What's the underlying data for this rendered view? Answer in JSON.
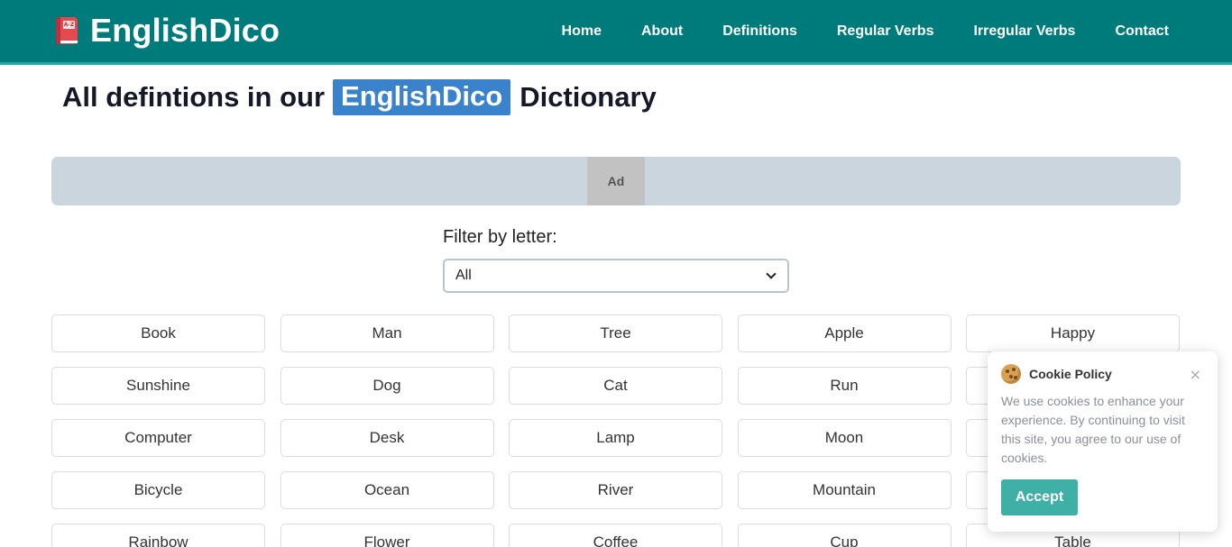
{
  "header": {
    "brand": "EnglishDico",
    "brand_icon": "book-az-icon",
    "brand_icon_text": "A-Z",
    "nav": [
      "Home",
      "About",
      "Definitions",
      "Regular Verbs",
      "Irregular Verbs",
      "Contact"
    ]
  },
  "title": {
    "before": "All defintions in our",
    "highlight": "EnglishDico",
    "after": "Dictionary"
  },
  "ad": {
    "label": "Ad"
  },
  "filter": {
    "label": "Filter by letter:",
    "selected": "All"
  },
  "words": [
    "Book",
    "Man",
    "Tree",
    "Apple",
    "Happy",
    "Sunshine",
    "Dog",
    "Cat",
    "Run",
    "",
    "Computer",
    "Desk",
    "Lamp",
    "Moon",
    "",
    "Bicycle",
    "Ocean",
    "River",
    "Mountain",
    "",
    "Rainbow",
    "Flower",
    "Coffee",
    "Cup",
    "Table"
  ],
  "cookie": {
    "title": "Cookie Policy",
    "text": "We use cookies to enhance your experience. By continuing to visit this site, you agree to our use of cookies.",
    "accept": "Accept",
    "close": "×"
  },
  "colors": {
    "header_bg": "#007b7c",
    "highlight_bg": "#3a82cc",
    "accept_bg": "#3fb0a6",
    "ad_bg": "#cbd5de"
  }
}
